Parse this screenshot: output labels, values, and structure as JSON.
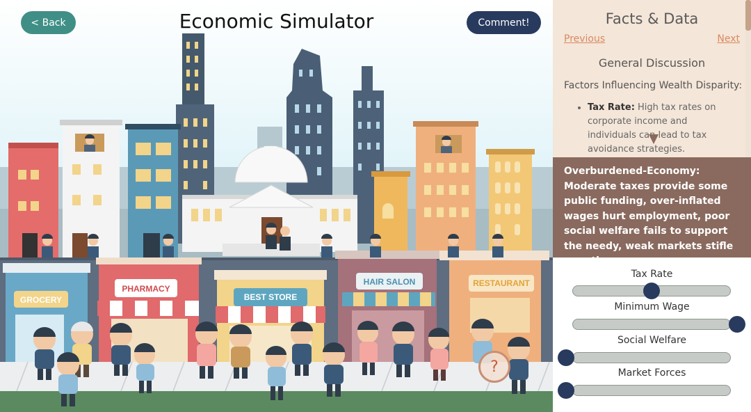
{
  "header": {
    "back_label": "< Back",
    "title": "Economic Simulator",
    "comment_label": "Comment!"
  },
  "shops": {
    "grocery": "GROCERY",
    "pharmacy": "PHARMACY",
    "best_store": "BEST STORE",
    "hair_salon": "HAIR SALON",
    "restaurant": "RESTAURANT"
  },
  "help_button": "?",
  "facts": {
    "title": "Facts & Data",
    "previous_label": "Previous",
    "next_label": "Next",
    "section": "General Discussion",
    "subheading": "Factors Influencing Wealth Disparity:",
    "items": [
      {
        "term": "Tax Rate:",
        "text": "High tax rates on corporate income and individuals can lead to tax avoidance strategies."
      }
    ]
  },
  "status": {
    "text": "Overburdened-Economy: Moderate taxes provide some public funding, over-inflated wages hurt employment, poor social welfare fails to support the needy, weak markets stifle growth."
  },
  "sliders": [
    {
      "label": "Tax Rate",
      "value": 0.5
    },
    {
      "label": "Minimum Wage",
      "value": 1.0
    },
    {
      "label": "Social Welfare",
      "value": 0.0
    },
    {
      "label": "Market Forces",
      "value": 0.0
    }
  ],
  "colors": {
    "back_button": "#3f8f86",
    "comment_button": "#283a5e",
    "facts_background": "#f4e6d8",
    "status_background": "#8a6a5e",
    "slider_thumb": "#283a5e",
    "link": "#d98962"
  }
}
